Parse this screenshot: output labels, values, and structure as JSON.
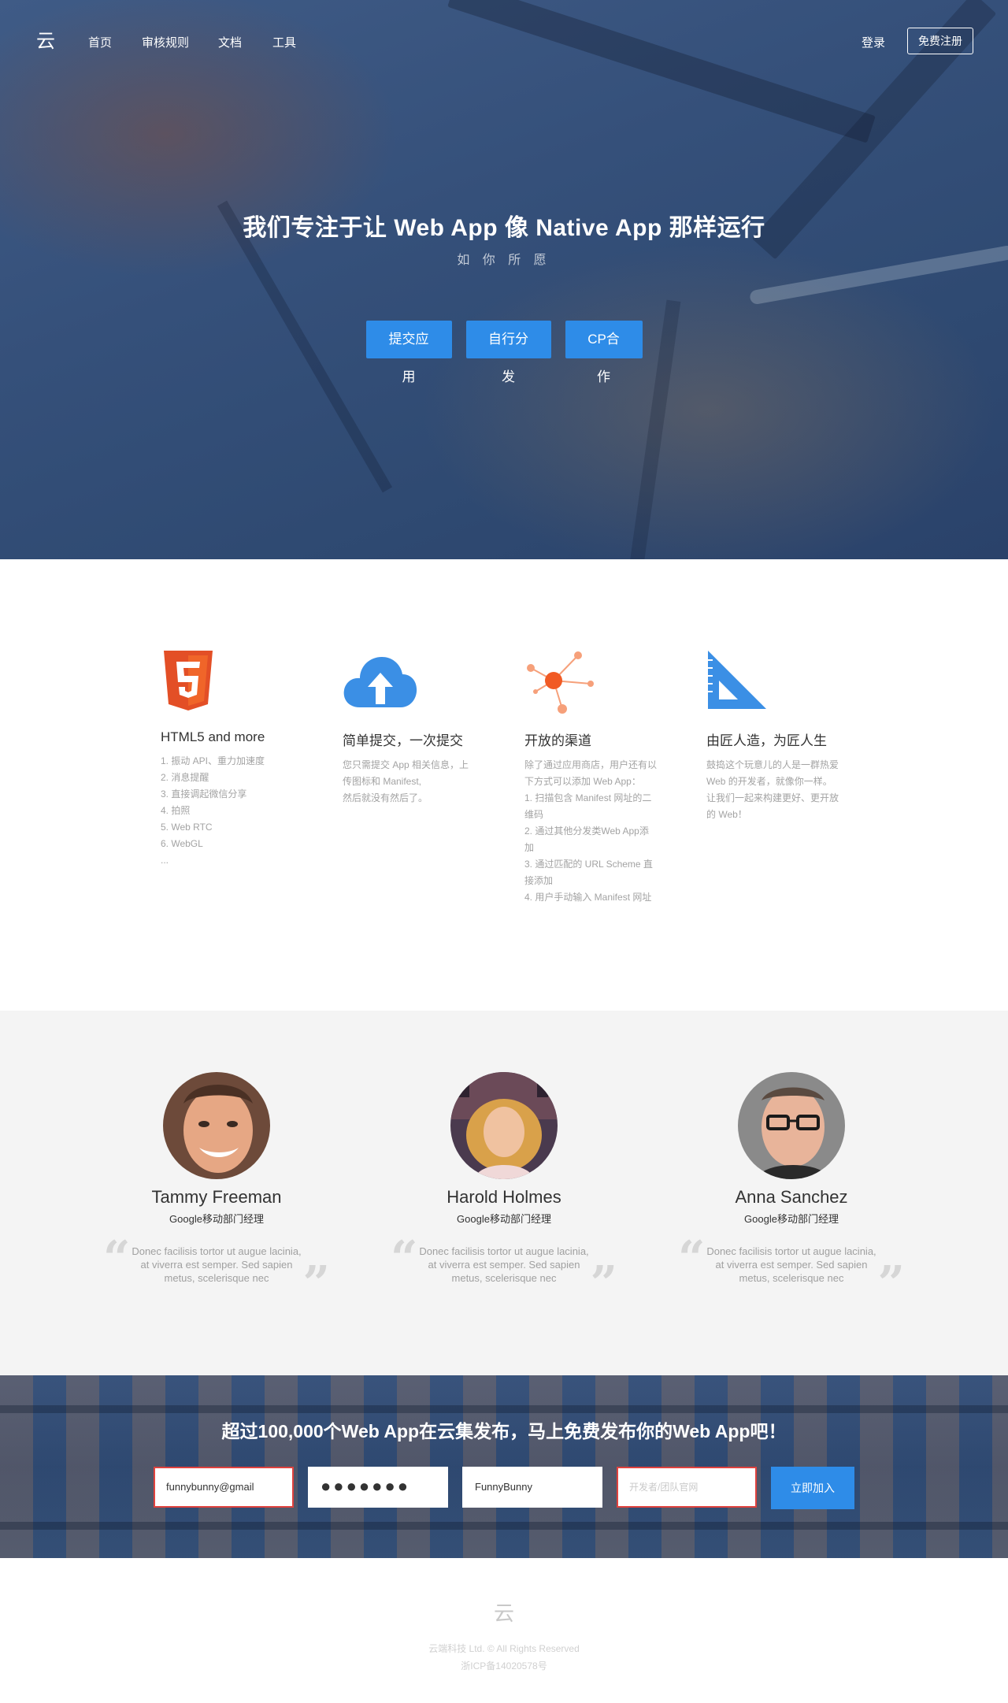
{
  "nav": {
    "logo": "云",
    "links": [
      "首页",
      "审核规则",
      "文档",
      "工具"
    ],
    "login": "登录",
    "signup": "免费注册"
  },
  "hero": {
    "title": "我们专注于让 Web App 像 Native App 那样运行",
    "subtitle": "如 你 所 愿",
    "buttons": [
      "提交应用",
      "自行分发",
      "CP合作"
    ]
  },
  "features": [
    {
      "icon": "html5-icon",
      "title": "HTML5 and more",
      "lines": [
        "1. 振动 API、重力加速度",
        "2. 消息提醒",
        "3. 直接调起微信分享",
        "4. 拍照",
        "5. Web RTC",
        "6. WebGL",
        "..."
      ]
    },
    {
      "icon": "cloud-upload-icon",
      "title": "简单提交，一次提交",
      "lines": [
        "您只需提交 App 相关信息，上",
        "传图标和 Manifest,",
        "然后就没有然后了。"
      ]
    },
    {
      "icon": "network-nodes-icon",
      "title": "开放的渠道",
      "lines": [
        "除了通过应用商店，用户还有以",
        "下方式可以添加 Web App：",
        "1. 扫描包含 Manifest 网址的二",
        "维码",
        "2. 通过其他分发类Web App添",
        "加",
        "3. 通过匹配的 URL Scheme 直",
        "接添加",
        "4. 用户手动输入 Manifest 网址"
      ]
    },
    {
      "icon": "set-square-icon",
      "title": "由匠人造，为匠人生",
      "lines": [
        "鼓捣这个玩意儿的人是一群热爱",
        "Web 的开发者，就像你一样。",
        "让我们一起来构建更好、更开放",
        "的 Web！"
      ]
    }
  ],
  "testimonials": [
    {
      "name": "Tammy Freeman",
      "role": "Google移动部门经理",
      "quote": "Donec facilisis tortor ut augue lacinia, at viverra est semper. Sed sapien metus, scelerisque nec"
    },
    {
      "name": "Harold Holmes",
      "role": "Google移动部门经理",
      "quote": "Donec facilisis tortor ut augue lacinia, at viverra est semper. Sed sapien metus, scelerisque nec"
    },
    {
      "name": "Anna Sanchez",
      "role": "Google移动部门经理",
      "quote": "Donec facilisis tortor ut augue lacinia, at viverra est semper. Sed sapien metus, scelerisque nec"
    }
  ],
  "cta": {
    "title": "超过100,000个Web App在云集发布，马上免费发布你的Web App吧！",
    "email_value": "funnybunny@gmail",
    "password_mask": "●●●●●●●",
    "username_value": "FunnyBunny",
    "site_placeholder": "开发者/团队官网",
    "join_button": "立即加入"
  },
  "footer": {
    "logo": "云",
    "copyright": "云端科技 Ltd. © All Rights Reserved",
    "icp": "浙ICP备14020578号"
  },
  "colors": {
    "accent": "#2e8ce8",
    "error_border": "#e0423e"
  }
}
